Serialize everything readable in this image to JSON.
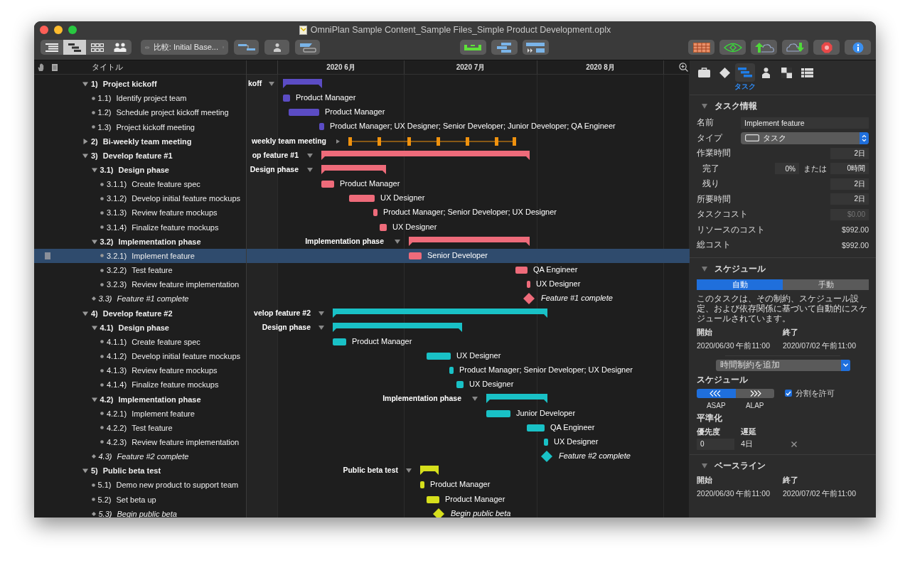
{
  "window": {
    "title": "OmniPlan Sample Content_Sample Files_Simple Product Development.oplx"
  },
  "toolbar": {
    "view_modes": [
      {
        "kind": "outline",
        "selected": false
      },
      {
        "kind": "gantt",
        "selected": true
      },
      {
        "kind": "network",
        "selected": false
      },
      {
        "kind": "resources",
        "selected": false
      }
    ],
    "compare": {
      "label": "比較: Initial Base..."
    }
  },
  "outline": {
    "column": "タイトル",
    "rows": [
      {
        "number": "1)",
        "title": "Project kickoff",
        "kind": "group",
        "expanded": true,
        "selected": false,
        "color": "#5b4cc4",
        "bar_label": "koff",
        "children": [
          {
            "number": "1.1)",
            "title": "Identify project team",
            "kind": "task",
            "selected": false,
            "bar_label": "Product Manager"
          },
          {
            "number": "1.2)",
            "title": "Schedule project kickoff meeting",
            "kind": "task",
            "selected": false,
            "bar_label": "Product Manager"
          },
          {
            "number": "1.3)",
            "title": "Project kickoff meeting",
            "kind": "task",
            "selected": false,
            "bar_label": "Product Manager; UX Designer; Senior Developer; Junior Developer; QA Engineer"
          }
        ]
      },
      {
        "number": "2)",
        "title": "Bi-weekly team meeting",
        "kind": "recurring",
        "expanded": false,
        "selected": false,
        "color": "#f0920e",
        "bar_label": "weekly team meeting"
      },
      {
        "number": "3)",
        "title": "Develop feature #1",
        "kind": "group",
        "expanded": true,
        "selected": false,
        "color": "#ee6b7a",
        "bar_label": "op feature #1",
        "children": [
          {
            "number": "3.1)",
            "title": "Design phase",
            "kind": "group",
            "expanded": true,
            "selected": false,
            "bar_label": "Design phase",
            "children": [
              {
                "number": "3.1.1)",
                "title": "Create feature spec",
                "kind": "task",
                "selected": false,
                "bar_label": "Product Manager"
              },
              {
                "number": "3.1.2)",
                "title": "Develop initial feature mockups",
                "kind": "task",
                "selected": false,
                "bar_label": "UX Designer"
              },
              {
                "number": "3.1.3)",
                "title": "Review feature mockups",
                "kind": "task",
                "selected": false,
                "bar_label": "Product Manager; Senior Developer; UX Designer"
              },
              {
                "number": "3.1.4)",
                "title": "Finalize feature mockups",
                "kind": "task",
                "selected": false,
                "bar_label": "UX Designer"
              }
            ]
          },
          {
            "number": "3.2)",
            "title": "Implementation phase",
            "kind": "group",
            "expanded": true,
            "selected": false,
            "bar_label": "Implementation phase",
            "children": [
              {
                "number": "3.2.1)",
                "title": "Implement feature",
                "kind": "task",
                "selected": true,
                "bar_label": "Senior Developer"
              },
              {
                "number": "3.2.2)",
                "title": "Test feature",
                "kind": "task",
                "selected": false,
                "bar_label": "QA Engineer"
              },
              {
                "number": "3.2.3)",
                "title": "Review feature implementation",
                "kind": "task",
                "selected": false,
                "bar_label": "UX Designer"
              }
            ]
          },
          {
            "number": "3.3)",
            "title": "Feature #1 complete",
            "kind": "milestone",
            "selected": false,
            "bar_label": "Feature #1 complete"
          }
        ]
      },
      {
        "number": "4)",
        "title": "Develop feature #2",
        "kind": "group",
        "expanded": true,
        "selected": false,
        "color": "#19c1c6",
        "bar_label": "velop feature #2",
        "children": [
          {
            "number": "4.1)",
            "title": "Design phase",
            "kind": "group",
            "expanded": true,
            "selected": false,
            "bar_label": "Design phase",
            "children": [
              {
                "number": "4.1.1)",
                "title": "Create feature spec",
                "kind": "task",
                "selected": false,
                "bar_label": "Product Manager"
              },
              {
                "number": "4.1.2)",
                "title": "Develop initial feature mockups",
                "kind": "task",
                "selected": false,
                "bar_label": "UX Designer"
              },
              {
                "number": "4.1.3)",
                "title": "Review feature mockups",
                "kind": "task",
                "selected": false,
                "bar_label": "Product Manager; Senior Developer; UX Designer"
              },
              {
                "number": "4.1.4)",
                "title": "Finalize feature mockups",
                "kind": "task",
                "selected": false,
                "bar_label": "UX Designer"
              }
            ]
          },
          {
            "number": "4.2)",
            "title": "Implementation phase",
            "kind": "group",
            "expanded": true,
            "selected": false,
            "bar_label": "Implementation phase",
            "children": [
              {
                "number": "4.2.1)",
                "title": "Implement feature",
                "kind": "task",
                "selected": false,
                "bar_label": "Junior Developer"
              },
              {
                "number": "4.2.2)",
                "title": "Test feature",
                "kind": "task",
                "selected": false,
                "bar_label": "QA Engineer"
              },
              {
                "number": "4.2.3)",
                "title": "Review feature implementation",
                "kind": "task",
                "selected": false,
                "bar_label": "UX Designer"
              }
            ]
          },
          {
            "number": "4.3)",
            "title": "Feature #2 complete",
            "kind": "milestone",
            "selected": false,
            "bar_label": "Feature #2 complete"
          }
        ]
      },
      {
        "number": "5)",
        "title": "Public beta test",
        "kind": "group",
        "expanded": true,
        "selected": false,
        "color": "#d6df1c",
        "bar_label": "Public beta test",
        "children": [
          {
            "number": "5.1)",
            "title": "Demo new product to support team",
            "kind": "task",
            "selected": false,
            "bar_label": "Product Manager"
          },
          {
            "number": "5.2)",
            "title": "Set beta up",
            "kind": "task",
            "selected": false,
            "bar_label": "Product Manager"
          },
          {
            "number": "5.3)",
            "title": "Begin public beta",
            "kind": "milestone",
            "selected": false,
            "bar_label": "Begin public beta"
          }
        ]
      }
    ]
  },
  "timeline": {
    "months": [
      "2020 6月",
      "2020 7月",
      "2020 8月"
    ]
  },
  "inspector": {
    "tabs": [
      {
        "kind": "project",
        "selected": false
      },
      {
        "kind": "milestone",
        "selected": false
      },
      {
        "kind": "task",
        "label": "タスク",
        "selected": true
      },
      {
        "kind": "resource",
        "selected": false
      },
      {
        "kind": "style",
        "selected": false
      },
      {
        "kind": "table",
        "selected": false
      }
    ],
    "task_info": {
      "heading": "タスク情報",
      "expanded": true,
      "name": {
        "label": "名前",
        "value": "Implement feature"
      },
      "type": {
        "label": "タイプ",
        "value": "タスク"
      },
      "effort": {
        "label": "作業時間",
        "value": "2日"
      },
      "complete": {
        "label": "完了",
        "percent": "0%",
        "or": "または",
        "hours": "0時間"
      },
      "remaining": {
        "label": "残り",
        "value": "2日"
      },
      "duration": {
        "label": "所要時間",
        "value": "2日"
      },
      "task_cost": {
        "label": "タスクコスト",
        "value": "$0.00",
        "disabled": true
      },
      "resource_cost": {
        "label": "リソースのコスト",
        "value": "$992.00"
      },
      "total_cost": {
        "label": "総コスト",
        "value": "$992.00"
      }
    },
    "schedule": {
      "heading": "スケジュール",
      "expanded": true,
      "modes": [
        {
          "label": "自動",
          "selected": true
        },
        {
          "label": "手動",
          "selected": false
        }
      ],
      "description": "このタスクは、その制約、スケジュール設定、および依存関係に基づいて自動的にスケジュールされています。",
      "start_label": "開始",
      "start": "2020/06/30 午前11:00",
      "end_label": "終了",
      "end": "2020/07/02 午前11:00",
      "constraint": "時間制約を追加",
      "scheduling_label": "スケジュール",
      "directions": [
        {
          "label": "ASAP",
          "selected": true
        },
        {
          "label": "ALAP",
          "selected": false
        }
      ],
      "allow_split": {
        "label": "分割を許可",
        "checked": true
      },
      "leveling_label": "平準化",
      "priority_label": "優先度",
      "priority": "0",
      "delay_label": "遅延",
      "delay": "4日"
    },
    "baseline": {
      "heading": "ベースライン",
      "expanded": true,
      "start_label": "開始",
      "start": "2020/06/30 午前11:00",
      "end_label": "終了",
      "end": "2020/07/02 午前11:00"
    }
  }
}
